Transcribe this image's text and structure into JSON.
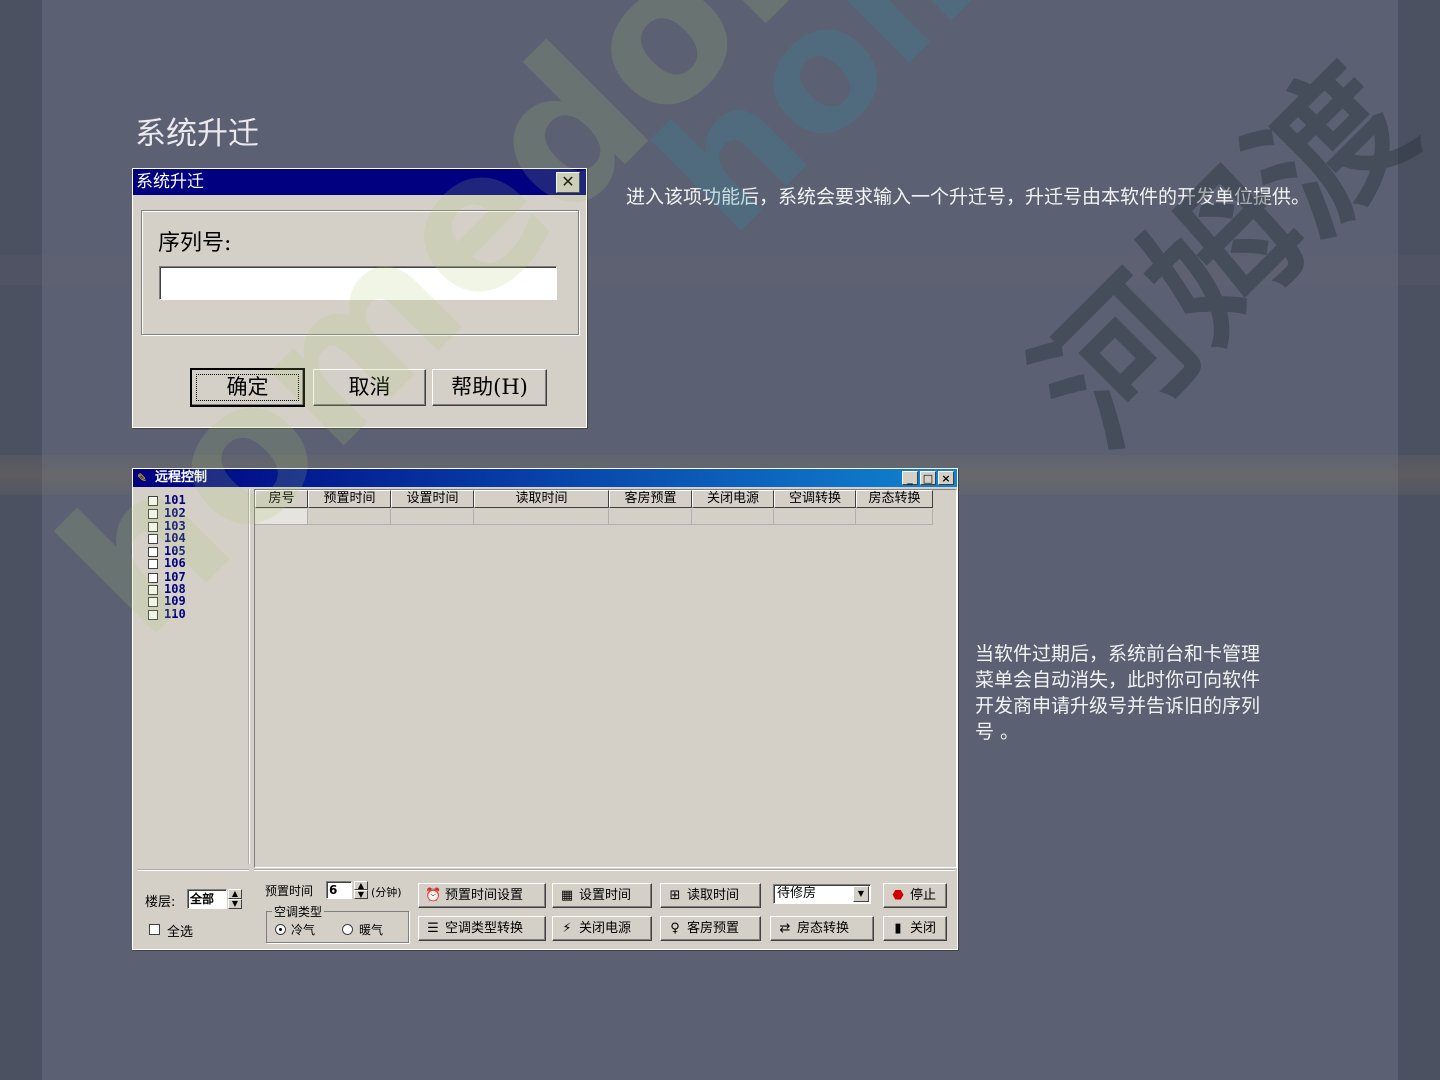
{
  "slide": {
    "title": "系统升迁",
    "description_1": "进入该项功能后，系统会要求输入一个升迁号，升迁号由本软件的开发单位提供。",
    "description_2": "当软件过期后，系统前台和卡管理菜单会自动消失，此时你可向软件开发商申请升级号并告诉旧的序列号 。"
  },
  "upgrade_dialog": {
    "title": "系统升迁",
    "close_glyph": "✕",
    "serial_label": "序列号:",
    "serial_value": "",
    "ok_label": "确定",
    "cancel_label": "取消",
    "help_label": "帮助(H)"
  },
  "remote_window": {
    "title": "远程控制",
    "min_glyph": "_",
    "max_glyph": "□",
    "close_glyph": "×",
    "rooms": [
      "101",
      "102",
      "103",
      "104",
      "105",
      "106",
      "107",
      "108",
      "109",
      "110"
    ],
    "columns": [
      "房号",
      "预置时间",
      "设置时间",
      "读取时间",
      "客房预置",
      "关闭电源",
      "空调转换",
      "房态转换"
    ],
    "floor_label": "楼层:",
    "floor_value": "全部",
    "select_all_label": "全选",
    "preset_time_label": "预置时间",
    "preset_time_value": "6",
    "preset_time_unit": "(分钟)",
    "ac_type_label": "空调类型",
    "ac_cold_label": "冷气",
    "ac_warm_label": "暖气",
    "status_combo_value": "待修房",
    "buttons": {
      "preset_time_setting": "预置时间设置",
      "set_time": "设置时间",
      "read_time": "读取时间",
      "stop": "停止",
      "ac_type_switch": "空调类型转换",
      "power_off": "关闭电源",
      "room_preset": "客房预置",
      "room_status_switch": "房态转换",
      "close": "关闭"
    }
  },
  "colors": {
    "background": "#5b6172",
    "dialog_title": "#000080",
    "room_text": "#000080",
    "window_face": "#d4d0c8"
  }
}
